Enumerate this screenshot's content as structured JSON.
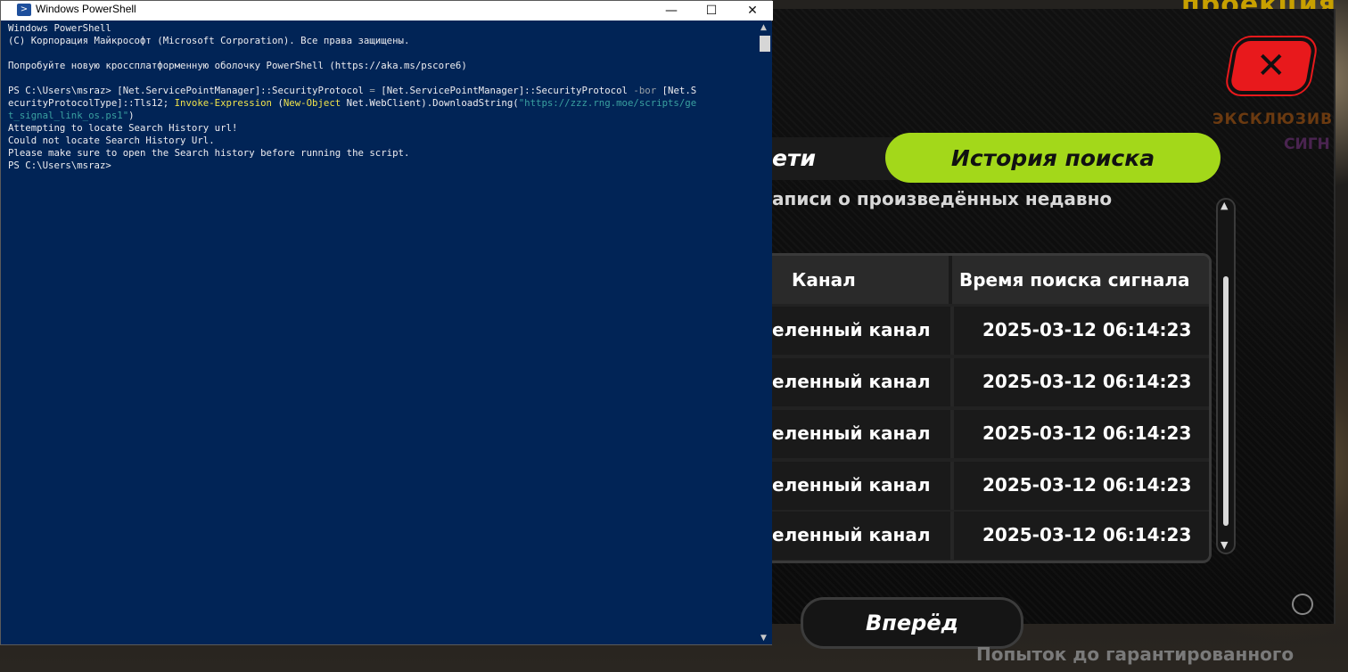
{
  "powershell": {
    "title": "Windows PowerShell",
    "controls": {
      "minimize": "—",
      "maximize": "☐",
      "close": "✕"
    },
    "lines": [
      [
        {
          "t": "Windows PowerShell",
          "c": ""
        }
      ],
      [
        {
          "t": "(C) Корпорация Майкрософт (Microsoft Corporation). Все права защищены.",
          "c": ""
        }
      ],
      [
        {
          "t": "",
          "c": ""
        }
      ],
      [
        {
          "t": "Попробуйте новую кроссплатформенную оболочку PowerShell (https://aka.ms/pscore6)",
          "c": ""
        }
      ],
      [
        {
          "t": "",
          "c": ""
        }
      ],
      [
        {
          "t": "PS C:\\Users\\msraz> ",
          "c": ""
        },
        {
          "t": "[Net.ServicePointManager]",
          "c": ""
        },
        {
          "t": "::SecurityProtocol ",
          "c": ""
        },
        {
          "t": "= ",
          "c": "c-gray"
        },
        {
          "t": "[Net.ServicePointManager]::SecurityProtocol ",
          "c": ""
        },
        {
          "t": "-bor ",
          "c": "c-gray"
        },
        {
          "t": "[Net.S",
          "c": ""
        }
      ],
      [
        {
          "t": "ecurityProtocolType]::Tls12; ",
          "c": ""
        },
        {
          "t": "Invoke-Expression ",
          "c": "c-yellow"
        },
        {
          "t": "(",
          "c": ""
        },
        {
          "t": "New-Object ",
          "c": "c-yellow"
        },
        {
          "t": "Net.WebClient).DownloadString(",
          "c": ""
        },
        {
          "t": "\"https://zzz.rng.moe/scripts/ge",
          "c": "c-cyan"
        }
      ],
      [
        {
          "t": "t_signal_link_os.ps1\"",
          "c": "c-cyan"
        },
        {
          "t": ")",
          "c": ""
        }
      ],
      [
        {
          "t": "Attempting to locate Search History url!",
          "c": ""
        }
      ],
      [
        {
          "t": "Could not locate Search History Url.",
          "c": ""
        }
      ],
      [
        {
          "t": "Please make sure to open the Search history before running the script.",
          "c": ""
        }
      ],
      [
        {
          "t": "PS C:\\Users\\msraz>",
          "c": ""
        }
      ]
    ]
  },
  "game": {
    "top_text": "проекция",
    "close_label": "✕",
    "exclusive_label_1": "ЭКСКЛЮЗИВ",
    "exclusive_label_2": "СИГН",
    "tabs": [
      {
        "label": "ети",
        "active": false
      },
      {
        "label": "История поиска",
        "active": true
      }
    ],
    "subtitle": "аписи о произведённых недавно",
    "table": {
      "headers": {
        "channel": "Канал",
        "time": "Время поиска сигнала"
      },
      "rows": [
        {
          "channel": "еленный канал",
          "time": "2025-03-12 06:14:23"
        },
        {
          "channel": "еленный канал",
          "time": "2025-03-12 06:14:23"
        },
        {
          "channel": "еленный канал",
          "time": "2025-03-12 06:14:23"
        },
        {
          "channel": "еленный канал",
          "time": "2025-03-12 06:14:23"
        },
        {
          "channel": "еленный канал",
          "time": "2025-03-12 06:14:23"
        }
      ]
    },
    "scroll_up": "▲",
    "scroll_down": "▼",
    "forward_button": "Вперёд",
    "bottom_text": "Попыток до гарантированного"
  },
  "colors": {
    "ps_background": "#012456",
    "accent_green": "#a3d81a",
    "close_red": "#e8191c"
  }
}
